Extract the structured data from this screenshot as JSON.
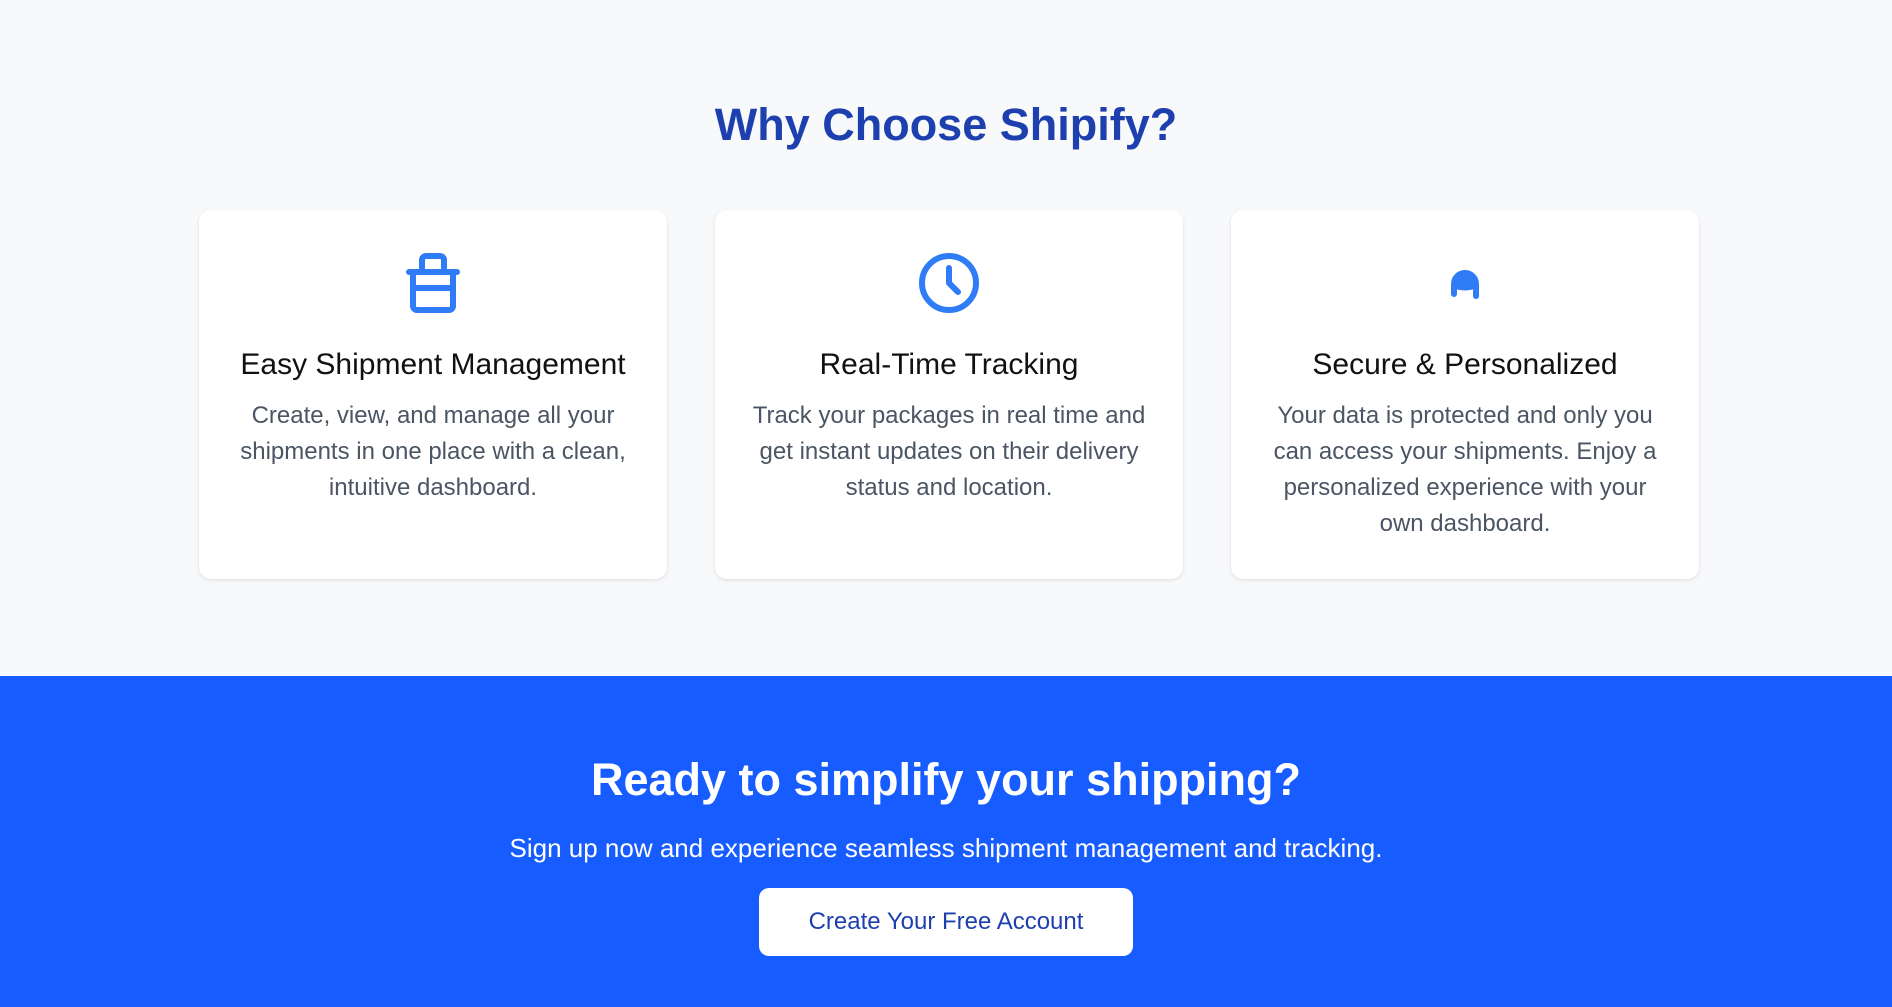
{
  "features": {
    "title": "Why Choose Shipify?",
    "cards": [
      {
        "icon": "shopping-basket-icon",
        "title": "Easy Shipment Management",
        "text": "Create, view, and manage all your shipments in one place with a clean, intuitive dashboard."
      },
      {
        "icon": "clock-icon",
        "title": "Real-Time Tracking",
        "text": "Track your packages in real time and get instant updates on their delivery status and location."
      },
      {
        "icon": "user-lock-icon",
        "title": "Secure & Personalized",
        "text": "Your data is protected and only you can access your shipments. Enjoy a personalized experience with your own dashboard."
      }
    ]
  },
  "cta": {
    "heading": "Ready to simplify your shipping?",
    "subtext": "Sign up now and experience seamless shipment management and tracking.",
    "button_label": "Create Your Free Account"
  },
  "colors": {
    "heading_blue": "#1e40af",
    "icon_blue": "#2f7cf6",
    "cta_background": "#175cff",
    "page_background": "#f8f9fb"
  }
}
